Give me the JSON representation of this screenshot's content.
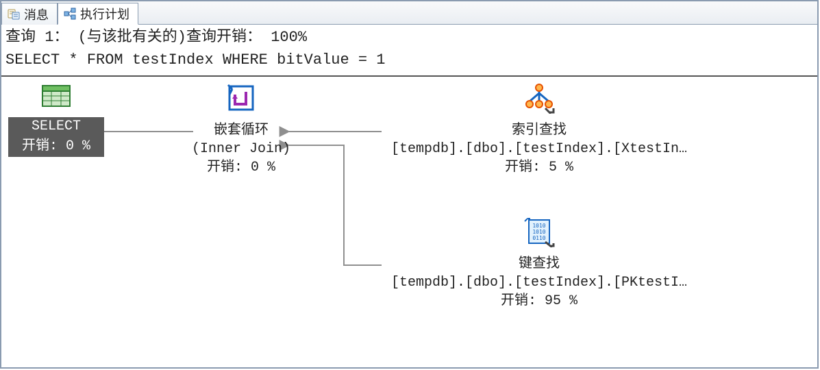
{
  "tabs": [
    {
      "label": "消息",
      "icon": "messages-icon"
    },
    {
      "label": "执行计划",
      "icon": "execution-plan-icon"
    }
  ],
  "query_header": {
    "line1": "查询 1： (与该批有关的)查询开销： 100%",
    "line2": "SELECT * FROM testIndex WHERE bitValue = 1"
  },
  "nodes": {
    "select": {
      "title": "SELECT",
      "cost": "开销: 0 %"
    },
    "nested_loop": {
      "title": "嵌套循环",
      "detail": "(Inner Join)",
      "cost": "开销: 0 %"
    },
    "index_seek": {
      "title": "索引查找",
      "detail": "[tempdb].[dbo].[testIndex].[XtestIn…",
      "cost": "开销: 5 %"
    },
    "key_lookup": {
      "title": "键查找",
      "detail": "[tempdb].[dbo].[testIndex].[PKtestI…",
      "cost": "开销: 95 %"
    }
  }
}
